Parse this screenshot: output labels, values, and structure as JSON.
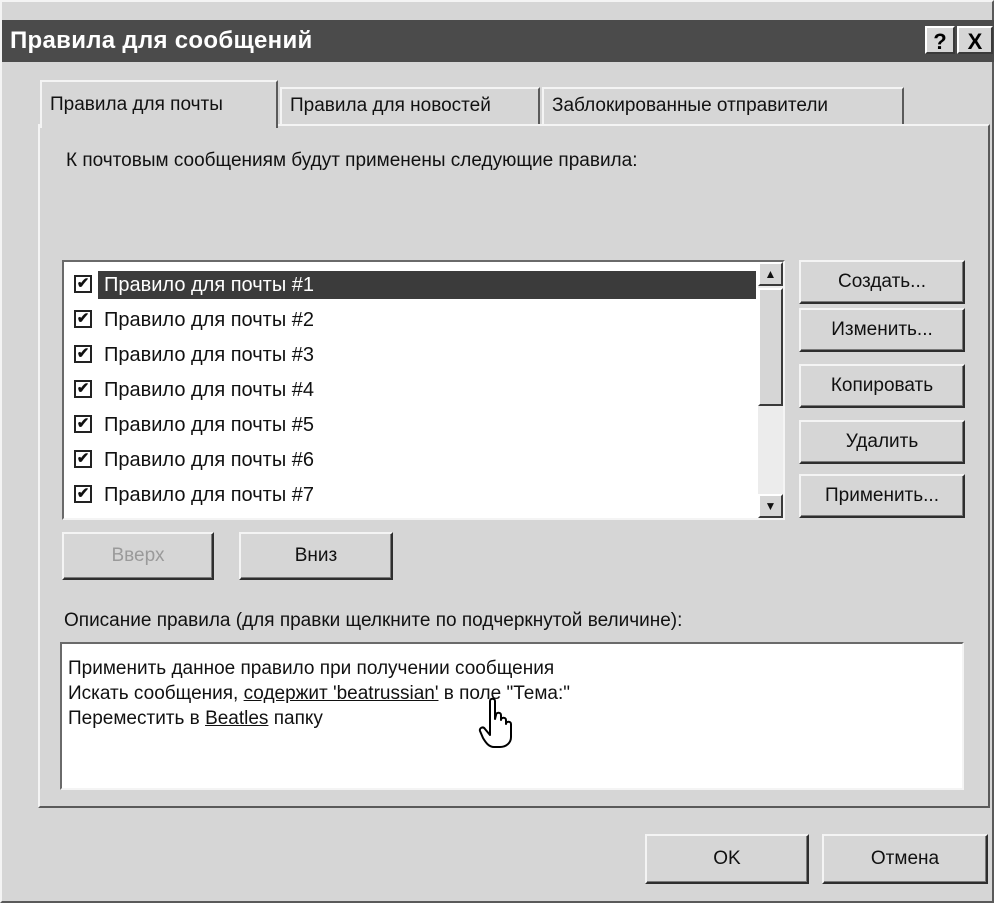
{
  "window": {
    "title": "Правила для сообщений",
    "help_label": "?",
    "close_label": "X"
  },
  "tabs": [
    {
      "label": "Правила для почты",
      "active": true
    },
    {
      "label": "Правила для новостей",
      "active": false
    },
    {
      "label": "Заблокированные отправители",
      "active": false
    }
  ],
  "heading": "К почтовым сообщениям будут применены следующие правила:",
  "rules": [
    {
      "label": "Правило для почты #1",
      "checked": true,
      "selected": true
    },
    {
      "label": "Правило для почты #2",
      "checked": true,
      "selected": false
    },
    {
      "label": "Правило для почты #3",
      "checked": true,
      "selected": false
    },
    {
      "label": "Правило для почты #4",
      "checked": true,
      "selected": false
    },
    {
      "label": "Правило для почты #5",
      "checked": true,
      "selected": false
    },
    {
      "label": "Правило для почты #6",
      "checked": true,
      "selected": false
    },
    {
      "label": "Правило для почты #7",
      "checked": true,
      "selected": false
    }
  ],
  "side_buttons": {
    "create": "Создать...",
    "edit": "Изменить...",
    "copy": "Копировать",
    "delete": "Удалить",
    "apply": "Применить..."
  },
  "move_buttons": {
    "up": "Вверх",
    "up_enabled": false,
    "down": "Вниз"
  },
  "description": {
    "label": "Описание правила (для правки щелкните по подчеркнутой величине):",
    "line1": "Применить данное правило при получении сообщения",
    "line2_prefix": "Искать сообщения, ",
    "line2_link": "содержит 'beatrussian'",
    "line2_suffix": " в поле \"Тема:\"",
    "line3_prefix": "Переместить в ",
    "line3_link": "Beatles",
    "line3_suffix": " папку"
  },
  "footer": {
    "ok": "OK",
    "cancel": "Отмена"
  },
  "icons": {
    "check": "✔",
    "scroll_up": "▲",
    "scroll_down": "▼",
    "cursor": "hand-pointer-icon"
  }
}
